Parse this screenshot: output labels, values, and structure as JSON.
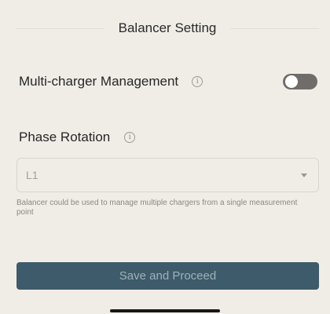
{
  "header": {
    "title": "Balancer Setting"
  },
  "multi_charger": {
    "label": "Multi-charger Management",
    "info_icon": "info-circle-icon",
    "toggle_on": false
  },
  "phase_rotation": {
    "label": "Phase Rotation",
    "info_icon": "info-circle-icon",
    "selected": "L1",
    "dropdown_icon": "chevron-down-icon"
  },
  "help_text": "Balancer could be used to manage multiple chargers from a single measurement point",
  "actions": {
    "save_label": "Save and Proceed"
  },
  "colors": {
    "background": "#f0ede7",
    "primary_button": "#3d5b6a",
    "primary_button_text": "#9fb1ba",
    "toggle_off_track": "#6f6c69"
  }
}
